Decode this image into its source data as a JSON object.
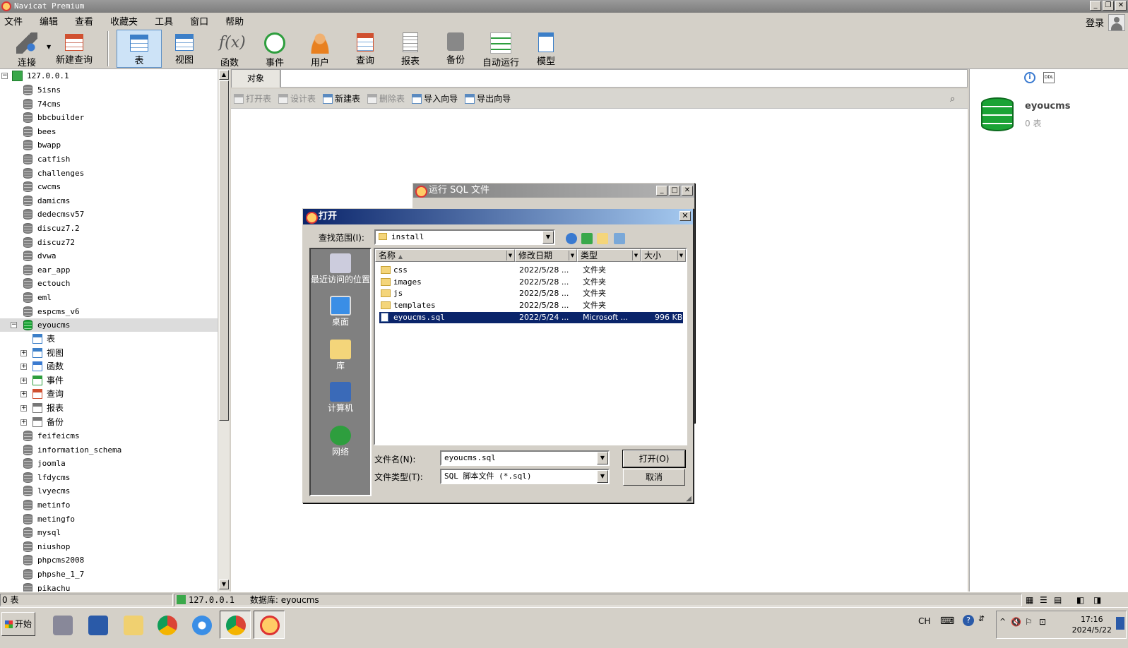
{
  "app": {
    "title": "Navicat Premium",
    "login": "登录"
  },
  "menu": [
    "文件",
    "编辑",
    "查看",
    "收藏夹",
    "工具",
    "窗口",
    "帮助"
  ],
  "toolbar": [
    {
      "label": "连接",
      "icon": "plug-icon"
    },
    {
      "label": "新建查询",
      "icon": "new-query-icon"
    },
    {
      "label": "表",
      "icon": "table-icon",
      "active": true
    },
    {
      "label": "视图",
      "icon": "view-icon"
    },
    {
      "label": "函数",
      "icon": "function-icon"
    },
    {
      "label": "事件",
      "icon": "clock-icon"
    },
    {
      "label": "用户",
      "icon": "user-icon"
    },
    {
      "label": "查询",
      "icon": "query-icon"
    },
    {
      "label": "报表",
      "icon": "report-icon"
    },
    {
      "label": "备份",
      "icon": "backup-icon"
    },
    {
      "label": "自动运行",
      "icon": "schedule-icon"
    },
    {
      "label": "模型",
      "icon": "model-icon"
    }
  ],
  "tree": {
    "connection": "127.0.0.1",
    "databases_before": [
      "5isns",
      "74cms",
      "bbcbuilder",
      "bees",
      "bwapp",
      "catfish",
      "challenges",
      "cwcms",
      "damicms",
      "dedecmsv57",
      "discuz7.2",
      "discuz72",
      "dvwa",
      "ear_app",
      "ectouch",
      "eml",
      "espcms_v6"
    ],
    "selected_db": "eyoucms",
    "children": [
      "表",
      "视图",
      "函数",
      "事件",
      "查询",
      "报表",
      "备份"
    ],
    "databases_after": [
      "feifeicms",
      "information_schema",
      "joomla",
      "lfdycms",
      "lvyecms",
      "metinfo",
      "metingfo",
      "mysql",
      "niushop",
      "phpcms2008",
      "phpshe_1_7",
      "pikachu"
    ]
  },
  "main": {
    "tab": "对象",
    "tools": [
      {
        "label": "打开表",
        "enabled": false
      },
      {
        "label": "设计表",
        "enabled": false
      },
      {
        "label": "新建表",
        "enabled": true
      },
      {
        "label": "删除表",
        "enabled": false
      },
      {
        "label": "导入向导",
        "enabled": true
      },
      {
        "label": "导出向导",
        "enabled": true
      }
    ]
  },
  "right": {
    "db_name": "eyoucms",
    "table_count": "0 表"
  },
  "status": {
    "left": "0 表",
    "connection": "127.0.0.1",
    "database": "数据库: eyoucms"
  },
  "sql_dialog": {
    "title": "运行 SQL 文件"
  },
  "open_dialog": {
    "title": "打开",
    "look_in_label": "查找范围(I):",
    "look_in": "install",
    "places": [
      "最近访问的位置",
      "桌面",
      "库",
      "计算机",
      "网络"
    ],
    "columns": [
      "名称",
      "修改日期",
      "类型",
      "大小"
    ],
    "files": [
      {
        "name": "css",
        "date": "2022/5/28 ...",
        "type": "文件夹",
        "size": "",
        "kind": "folder"
      },
      {
        "name": "images",
        "date": "2022/5/28 ...",
        "type": "文件夹",
        "size": "",
        "kind": "folder"
      },
      {
        "name": "js",
        "date": "2022/5/28 ...",
        "type": "文件夹",
        "size": "",
        "kind": "folder"
      },
      {
        "name": "templates",
        "date": "2022/5/28 ...",
        "type": "文件夹",
        "size": "",
        "kind": "folder"
      },
      {
        "name": "eyoucms.sql",
        "date": "2022/5/24 ...",
        "type": "Microsoft ...",
        "size": "996 KB",
        "kind": "file",
        "selected": true
      }
    ],
    "filename_label": "文件名(N):",
    "filename": "eyoucms.sql",
    "filetype_label": "文件类型(T):",
    "filetype": "SQL 脚本文件 (*.sql)",
    "open_button": "打开(O)",
    "cancel_button": "取消"
  },
  "taskbar": {
    "start": "开始",
    "lang": "CH",
    "time": "17:16",
    "date": "2024/5/22"
  }
}
